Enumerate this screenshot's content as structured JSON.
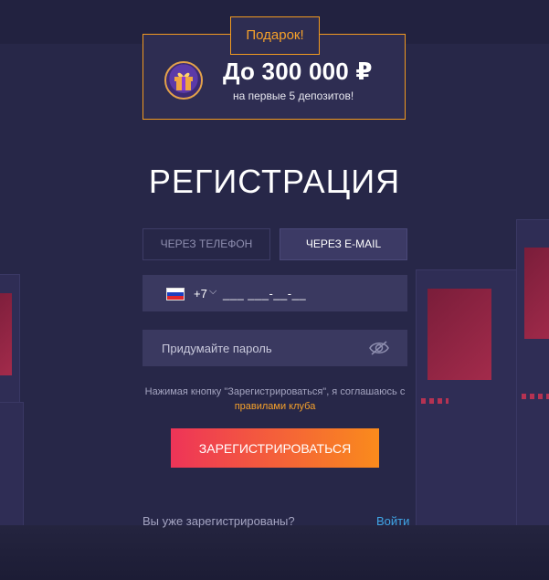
{
  "promo": {
    "label": "Подарок!",
    "amount": "До 300 000 ₽",
    "subtitle": "на первые 5 депозитов!"
  },
  "title": "РЕГИСТРАЦИЯ",
  "tabs": [
    {
      "label": "ЧЕРЕЗ ТЕЛЕФОН",
      "active": false
    },
    {
      "label": "ЧЕРЕЗ E-MAIL",
      "active": true
    }
  ],
  "phone": {
    "country_code": "+7",
    "mask": "___ ___-__-__"
  },
  "password": {
    "placeholder": "Придумайте пароль"
  },
  "agreement": {
    "text": "Нажимая кнопку \"Зарегистрироваться\", я соглашаюсь с",
    "link": "правилами клуба"
  },
  "submit_label": "ЗАРЕГИСТРИРОВАТЬСЯ",
  "footer": {
    "question": "Вы уже зарегистрированы?",
    "login": "Войти"
  },
  "icons": {
    "gift": "gift-icon",
    "flag": "russia-flag-icon",
    "chevron": "chevron-down-icon",
    "eye": "eye-off-icon"
  },
  "colors": {
    "background": "#272748",
    "accent": "#f29a20",
    "link": "#3fa6e6",
    "button_start": "#ee3458",
    "button_end": "#fa8b1c"
  }
}
